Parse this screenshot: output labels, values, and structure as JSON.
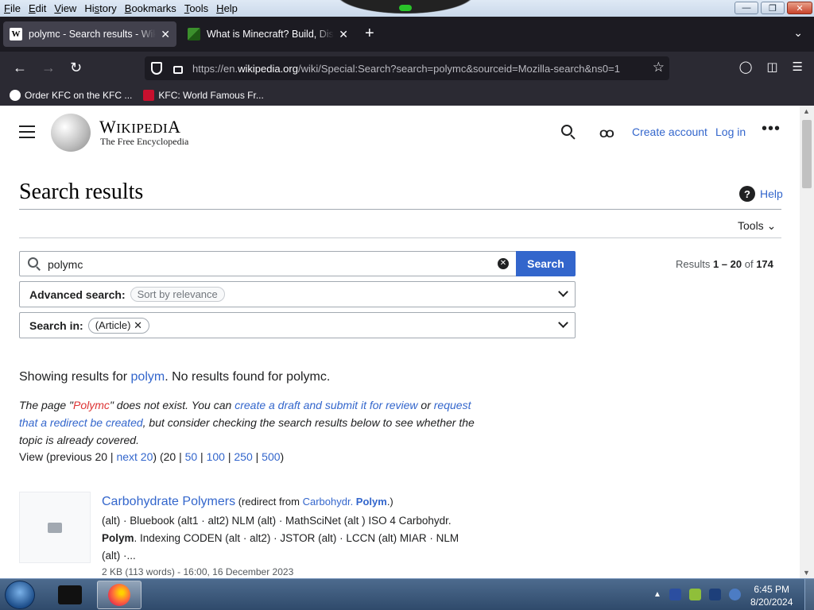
{
  "menubar": {
    "items": [
      "File",
      "Edit",
      "View",
      "History",
      "Bookmarks",
      "Tools",
      "Help"
    ],
    "accel": [
      "F",
      "E",
      "V",
      "s",
      "B",
      "T",
      "H"
    ]
  },
  "tabs": [
    {
      "title": "polymc - Search results - Wikipedia",
      "favicon": "wikipedia-icon",
      "active": true
    },
    {
      "title": "What is Minecraft? Build, Discover",
      "favicon": "minecraft-icon",
      "active": false
    }
  ],
  "urlbar": {
    "prefix": "https://en.",
    "domain": "wikipedia.org",
    "path": "/wiki/Special:Search?search=polymc&sourceid=Mozilla-search&ns0=1"
  },
  "bookmarks": [
    {
      "label": "Order KFC on the KFC ...",
      "icon": "globe-icon"
    },
    {
      "label": "KFC: World Famous Fr...",
      "icon": "kfc-icon"
    }
  ],
  "wiki_header": {
    "wordmark_first": "W",
    "wordmark_rest": "IKIPEDI",
    "wordmark_last": "A",
    "tagline": "The Free Encyclopedia",
    "create_account": "Create account",
    "log_in": "Log in"
  },
  "page": {
    "title": "Search results",
    "help": "Help",
    "tools": "Tools"
  },
  "search": {
    "value": "polymc",
    "button": "Search",
    "results_prefix": "Results ",
    "results_range": "1 – 20",
    "results_of": " of ",
    "results_total": "174"
  },
  "advanced": {
    "label": "Advanced search:",
    "chip": "Sort by relevance"
  },
  "search_in": {
    "label": "Search in:",
    "chip": "(Article)"
  },
  "showing": {
    "prefix": "Showing results for ",
    "link": "polym",
    "suffix": ". No results found for polymc."
  },
  "notice": {
    "t1": "The page \"",
    "red": "Polymc",
    "t2": "\" does not exist. You can ",
    "link1": "create a draft and submit it for review",
    "t3": " or ",
    "link2": "request that a redirect be created",
    "t4": ", but consider checking the search results below to see whether the topic is already covered."
  },
  "paging": {
    "t1": "View (previous 20 | ",
    "next": "next 20",
    "t2": ") (20 | ",
    "p50": "50",
    "sep": " | ",
    "p100": "100",
    "p250": "250",
    "p500": "500",
    "end": ")"
  },
  "result": {
    "title": "Carbohydrate Polymers",
    "redirect_prefix": " (redirect from ",
    "redirect_link": "Carbohydr. ",
    "redirect_bold": "Polym",
    "redirect_suffix": ".)",
    "snippet_a": "(alt) · Bluebook (alt1 · alt2) NLM (alt) · MathSciNet (alt ) ISO 4 Carbohydr. ",
    "snippet_bold": "Polym",
    "snippet_b": ". Indexing CODEN (alt · alt2) · JSTOR (alt) · LCCN (alt) MIAR · NLM (alt) ·...",
    "meta": "2 KB (113 words) - 16:00, 16 December 2023"
  },
  "taskbar": {
    "time": "6:45 PM",
    "date": "8/20/2024"
  },
  "colors": {
    "link": "#3366cc",
    "search_button": "#3366cc",
    "red_link": "#dd3333"
  }
}
